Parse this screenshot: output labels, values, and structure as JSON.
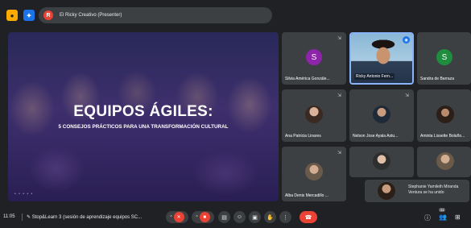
{
  "top_bar": {
    "presenter_label": "El Ricky Creativo (Presenter)"
  },
  "slide": {
    "title": "EQUIPOS ÁGILES:",
    "subtitle": "5 CONSEJOS PRÁCTICOS PARA UNA TRANSFORMACIÓN CULTURAL"
  },
  "participants": [
    {
      "name": "Silvia América Gonzále...",
      "initial": "S",
      "avatar_color": "#8e24aa"
    },
    {
      "name": "Ricky Antonio Fern...",
      "speaking": true
    },
    {
      "name": "Sandra de Barraza",
      "initial": "S",
      "avatar_color": "#1e8e3e"
    },
    {
      "name": "Ana Patricia Linares"
    },
    {
      "name": "Nelson Jose Ayala Astu..."
    },
    {
      "name": "Aminta Lissette Bolaño..."
    },
    {
      "name": "Alba Denis Mercadillo ..."
    },
    {
      "name": ""
    },
    {
      "name": ""
    }
  ],
  "toast": {
    "message": "Stephanie Yamileth Miranda Ventura se ha unido"
  },
  "bottom_bar": {
    "time": "11:05",
    "meeting_title": "Stop&Learn 3 (sesión de aprendizaje equipos SC...",
    "participant_count": "24"
  },
  "icons": {
    "mic": "mic-off-icon",
    "camera": "camera-off-icon",
    "captions": "captions-icon",
    "emoji": "emoji-icon",
    "present": "present-icon",
    "hand": "raise-hand-icon",
    "more": "more-options-icon",
    "end_call": "end-call-icon",
    "info": "info-icon",
    "people": "people-icon",
    "activities": "activities-icon"
  },
  "colors": {
    "background": "#202124",
    "tile": "#3c4043",
    "danger": "#ea4335",
    "accent": "#8ab4f8"
  }
}
